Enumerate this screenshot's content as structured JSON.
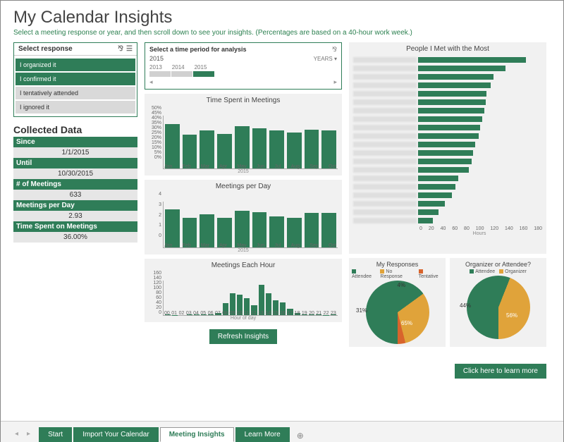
{
  "header": {
    "title": "My Calendar Insights",
    "subtitle": "Select a meeting response or year, and then scroll down to see your insights. (Percentages are based on a 40-hour work week.)"
  },
  "slicer": {
    "title": "Select response",
    "items": [
      {
        "label": "I organized it",
        "selected": true
      },
      {
        "label": "I confirmed it",
        "selected": true
      },
      {
        "label": "I tentatively attended",
        "selected": false
      },
      {
        "label": "I ignored it",
        "selected": false
      }
    ]
  },
  "timeline": {
    "title": "Select a time period for analysis",
    "value": "2015",
    "unit": "YEARS",
    "years": [
      "2013",
      "2014",
      "2015"
    ],
    "selected_index": 2
  },
  "collected": {
    "title": "Collected Data",
    "rows": [
      {
        "label": "Since",
        "value": "1/1/2015"
      },
      {
        "label": "Until",
        "value": "10/30/2015"
      },
      {
        "label": "# of Meetings",
        "value": "633"
      },
      {
        "label": "Meetings per Day",
        "value": "2.93"
      },
      {
        "label": "Time Spent on Meetings",
        "value": "36.00%"
      }
    ]
  },
  "buttons": {
    "refresh": "Refresh Insights",
    "learn_more": "Click here to learn more"
  },
  "tabs": {
    "items": [
      "Start",
      "Import Your Calendar",
      "Meeting Insights",
      "Learn More"
    ],
    "active_index": 2
  },
  "colors": {
    "primary": "#2f7d58",
    "accent_yellow": "#e0a33a",
    "accent_orange": "#d8642c"
  },
  "chart_data": [
    {
      "id": "time_spent",
      "type": "bar",
      "title": "Time Spent in Meetings",
      "categories": [
        "Jan",
        "Feb",
        "Mar",
        "Apr",
        "May",
        "Jun",
        "Jul",
        "Aug",
        "Sep",
        "Oct"
      ],
      "values": [
        42,
        32,
        36,
        33,
        40,
        38,
        36,
        34,
        37,
        36
      ],
      "ylabel": "",
      "ylim": [
        0,
        50
      ],
      "yticks": [
        "0%",
        "5%",
        "10%",
        "15%",
        "20%",
        "25%",
        "30%",
        "35%",
        "40%",
        "45%",
        "50%"
      ],
      "xlabel": "2015"
    },
    {
      "id": "meetings_per_day",
      "type": "bar",
      "title": "Meetings per Day",
      "categories": [
        "Jan",
        "Feb",
        "Mar",
        "Apr",
        "May",
        "Jun",
        "Jul",
        "Aug",
        "Sep",
        "Oct"
      ],
      "values": [
        3.3,
        2.6,
        2.9,
        2.6,
        3.2,
        3.1,
        2.7,
        2.6,
        3.0,
        3.0
      ],
      "ylim": [
        0,
        4
      ],
      "yticks": [
        "0",
        "1",
        "2",
        "3",
        "4"
      ],
      "xlabel": "2015"
    },
    {
      "id": "meetings_each_hour",
      "type": "bar",
      "title": "Meetings Each Hour",
      "categories": [
        "00",
        "01",
        "02",
        "03",
        "04",
        "05",
        "06",
        "07",
        "08",
        "09",
        "10",
        "11",
        "12",
        "13",
        "14",
        "15",
        "16",
        "17",
        "18",
        "19",
        "20",
        "21",
        "22",
        "23"
      ],
      "values": [
        2,
        1,
        0,
        2,
        3,
        2,
        4,
        10,
        55,
        100,
        95,
        80,
        45,
        140,
        100,
        70,
        60,
        30,
        10,
        4,
        2,
        2,
        1,
        2
      ],
      "ylim": [
        0,
        160
      ],
      "yticks": [
        "0",
        "20",
        "40",
        "60",
        "80",
        "100",
        "120",
        "140",
        "160"
      ],
      "xlabel": "Hour of day"
    },
    {
      "id": "people_met",
      "type": "bar",
      "orientation": "horizontal",
      "title": "People I Met with the Most",
      "xlabel": "Hours",
      "xlim": [
        0,
        180
      ],
      "xticks": [
        "0",
        "20",
        "40",
        "60",
        "80",
        "100",
        "120",
        "140",
        "160",
        "180"
      ],
      "categories": [
        "(name)",
        "(name)",
        "(name)",
        "(name)",
        "(name)",
        "(name)",
        "(name)",
        "(name)",
        "(name)",
        "(name)",
        "(name)",
        "(name)",
        "(name)",
        "(name)",
        "(name)",
        "(name)",
        "(name)",
        "(name)",
        "(name)",
        "(name)"
      ],
      "values": [
        160,
        130,
        112,
        108,
        102,
        100,
        98,
        95,
        92,
        90,
        85,
        82,
        80,
        75,
        60,
        55,
        50,
        40,
        30,
        22
      ]
    },
    {
      "id": "my_responses",
      "type": "pie",
      "title": "My Responses",
      "series": [
        {
          "name": "Attendee",
          "value": 65,
          "color": "#2f7d58"
        },
        {
          "name": "No Response",
          "value": 31,
          "color": "#e0a33a"
        },
        {
          "name": "Tentative",
          "value": 4,
          "color": "#d8642c"
        }
      ]
    },
    {
      "id": "organizer_attendee",
      "type": "pie",
      "title": "Organizer or Attendee?",
      "series": [
        {
          "name": "Attendee",
          "value": 56,
          "color": "#2f7d58"
        },
        {
          "name": "Organizer",
          "value": 44,
          "color": "#e0a33a"
        }
      ]
    }
  ]
}
